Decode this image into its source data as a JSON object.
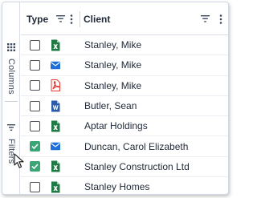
{
  "side_panel": {
    "columns_label": "Columns",
    "filters_label": "Filters"
  },
  "header": {
    "type_label": "Type",
    "client_label": "Client"
  },
  "rows": [
    {
      "icon": "excel-file-icon",
      "checked": false,
      "client": "Stanley, Mike"
    },
    {
      "icon": "email-icon",
      "checked": false,
      "client": "Stanley, Mike"
    },
    {
      "icon": "pdf-file-icon",
      "checked": false,
      "client": "Stanley, Mike"
    },
    {
      "icon": "word-file-icon",
      "checked": false,
      "client": "Butler, Sean"
    },
    {
      "icon": "excel-file-icon",
      "checked": false,
      "client": "Aptar Holdings"
    },
    {
      "icon": "email-icon",
      "checked": true,
      "client": "Duncan, Carol Elizabeth"
    },
    {
      "icon": "excel-file-icon",
      "checked": true,
      "client": "Stanley Construction Ltd"
    },
    {
      "icon": "excel-file-icon",
      "checked": false,
      "client": "Stanley Homes"
    }
  ],
  "colors": {
    "checkbox_checked": "#3aa676",
    "excel_green": "#1f7a45",
    "email_blue": "#1e6fd9",
    "pdf_red": "#e53935",
    "word_blue": "#2b5aa8"
  }
}
